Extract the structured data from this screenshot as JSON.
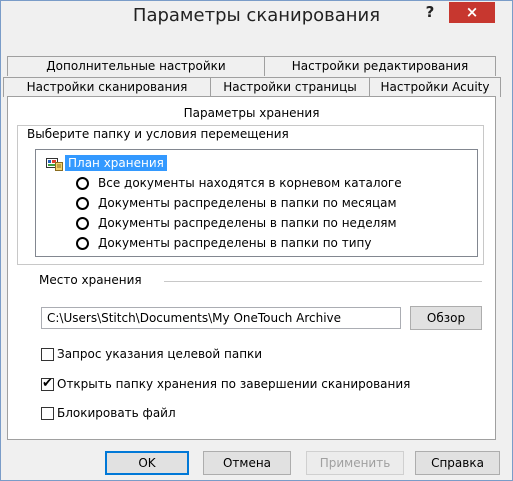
{
  "window": {
    "title": "Параметры сканирования",
    "help_icon": "?",
    "close_icon": "×"
  },
  "tabs_row1": [
    {
      "label": "Дополнительные настройки"
    },
    {
      "label": "Настройки редактирования"
    }
  ],
  "tabs_row2": [
    {
      "label": "Настройки сканирования"
    },
    {
      "label": "Настройки страницы"
    },
    {
      "label": "Настройки Acuity"
    }
  ],
  "panel": {
    "title": "Параметры хранения",
    "group_label": "Выберите папку и условия перемещения",
    "tree": {
      "root_label": "План хранения",
      "options": [
        {
          "label": "Все документы находятся в корневом каталоге"
        },
        {
          "label": "Документы распределены в папки по месяцам"
        },
        {
          "label": "Документы распределены в папки по неделям"
        },
        {
          "label": "Документы распределены в папки по типу"
        }
      ]
    },
    "location": {
      "label": "Место хранения",
      "path": "C:\\Users\\Stitch\\Documents\\My OneTouch Archive",
      "browse_label": "Обзор"
    },
    "checkboxes": [
      {
        "label": "Запрос указания целевой папки",
        "checked": false
      },
      {
        "label": "Открыть папку хранения по завершении сканирования",
        "checked": true
      },
      {
        "label": "Блокировать файл",
        "checked": false
      }
    ]
  },
  "buttons": {
    "ok": "OK",
    "cancel": "Отмена",
    "apply": "Применить",
    "help": "Справка"
  },
  "colors": {
    "selection": "#3399ff",
    "close_button": "#c7372f"
  }
}
